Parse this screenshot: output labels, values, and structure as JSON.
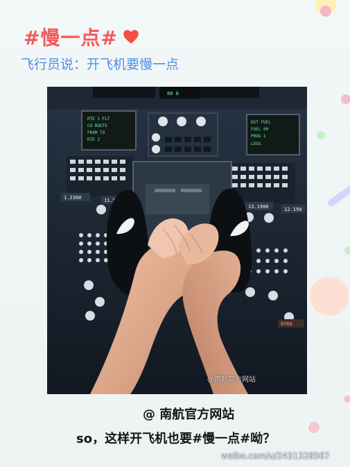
{
  "header": {
    "title": "#慢一点#",
    "subtitle": "飞行员说：开飞机要慢一点"
  },
  "image": {
    "watermark": "@南航官方网站"
  },
  "caption": {
    "author": "@ 南航官方网站",
    "text": "so，这样开飞机也要#慢一点#呦？"
  },
  "footer": {
    "url": "weibo.com/u/2431328567"
  },
  "colors": {
    "title": "#f35a59",
    "subtitle": "#4f8fe8",
    "background": "#eef4f4",
    "caption": "#151515"
  },
  "icons": {
    "title_icon": "heart-icon"
  }
}
